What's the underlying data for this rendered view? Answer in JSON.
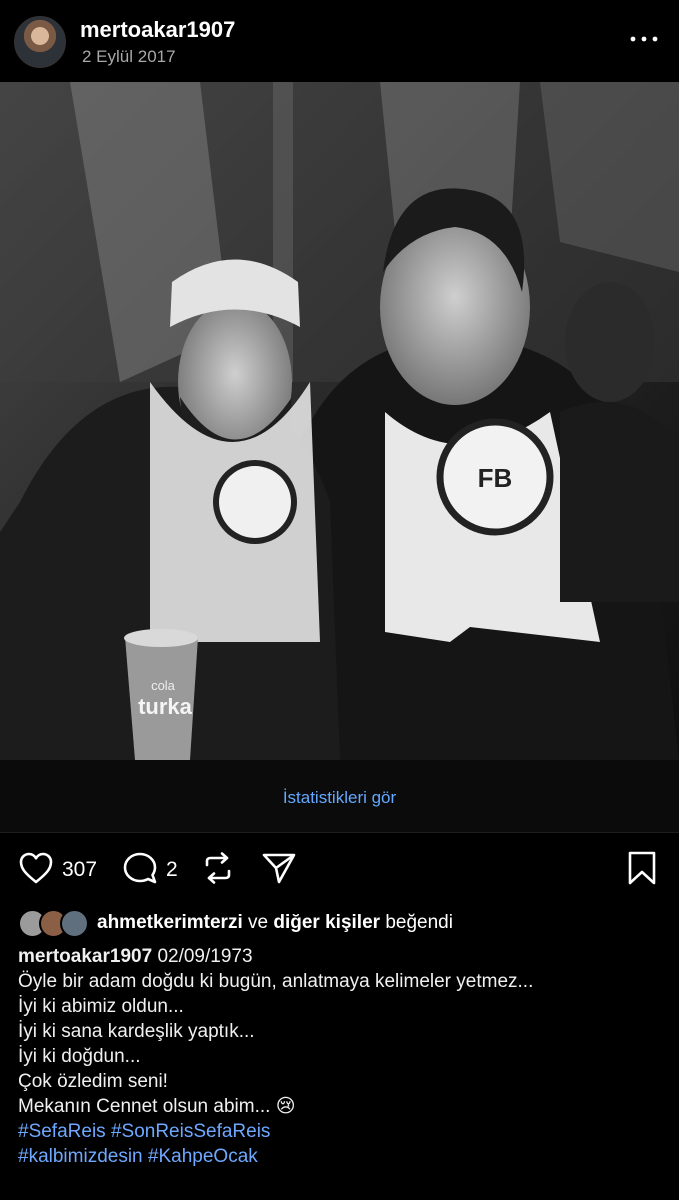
{
  "post": {
    "username": "mertoakar1907",
    "date": "2 Eylül 2017",
    "photo_alt": "Siyah beyaz fotoğraf",
    "cup_text_top": "cola",
    "cup_text_bottom": "turka"
  },
  "stats": {
    "link": "İstatistikleri gör"
  },
  "actions": {
    "likes": "307",
    "comments": "2"
  },
  "liked_by": {
    "user": "ahmetkerimterzi",
    "joiner": "ve",
    "others": "diğer kişiler",
    "suffix": "beğendi"
  },
  "caption": {
    "username": "mertoakar1907",
    "line1_rest": "02/09/1973",
    "line2": "Öyle bir adam doğdu ki bugün, anlatmaya kelimeler yetmez...",
    "line3": "İyi ki abimiz oldun...",
    "line4": "İyi ki sana kardeşlik yaptık...",
    "line5": "İyi ki doğdun...",
    "line6": "Çok özledim seni!",
    "line7": "Mekanın Cennet olsun abim...",
    "line7_emoji": "😢",
    "tags_line1": [
      "#SefaReis",
      "#SonReisSefaReis"
    ],
    "tags_line2": [
      "#kalbimizdesin",
      "#KahpeOcak"
    ]
  },
  "colors": {
    "link": "#64a8ff",
    "hashtag": "#6ea8ff",
    "background": "#000000"
  },
  "icons": [
    "more-icon",
    "heart-icon",
    "comment-icon",
    "repost-icon",
    "share-icon",
    "bookmark-icon"
  ]
}
